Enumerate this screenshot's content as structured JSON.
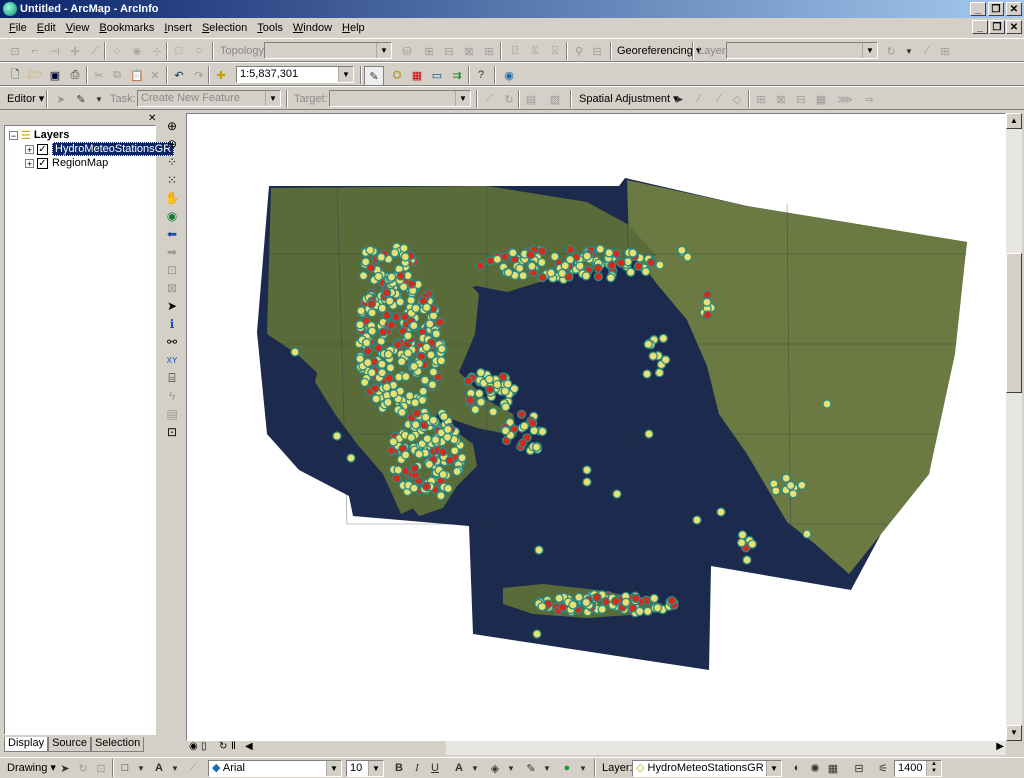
{
  "window": {
    "title": "Untitled - ArcMap - ArcInfo",
    "buttons": [
      "_",
      "❐",
      "✕"
    ]
  },
  "menubar": {
    "items": [
      {
        "key": "F",
        "rest": "ile"
      },
      {
        "key": "E",
        "rest": "dit"
      },
      {
        "key": "V",
        "rest": "iew"
      },
      {
        "key": "B",
        "rest": "ookmarks"
      },
      {
        "key": "I",
        "rest": "nsert"
      },
      {
        "key": "S",
        "rest": "election"
      },
      {
        "key": "T",
        "rest": "ools"
      },
      {
        "key": "W",
        "rest": "indow"
      },
      {
        "key": "H",
        "rest": "elp"
      }
    ]
  },
  "topology_toolbar": {
    "topology_label": "Topology:",
    "georeferencing_label": "Georeferencing",
    "layer_label": "Layer:"
  },
  "standard_toolbar": {
    "scale_value": "1:5,837,301"
  },
  "editor_toolbar": {
    "editor_label": "Editor",
    "task_label": "Task:",
    "task_value": "Create New Feature",
    "target_label": "Target:",
    "spatial_adjustment_label": "Spatial Adjustment"
  },
  "toc": {
    "root_label": "Layers",
    "layers": [
      {
        "name": "HydroMeteoStationsGR",
        "checked": true,
        "selected": true
      },
      {
        "name": "RegionMap",
        "checked": true,
        "selected": false
      }
    ],
    "tabs": [
      "Display",
      "Source",
      "Selection"
    ],
    "active_tab": "Display"
  },
  "map": {
    "colors": {
      "sea": "#1c2a4e",
      "land": "#5a6b3a",
      "station_fill": "#e8e070",
      "station_ring": "#2a8a86",
      "station_highlight": "#d42a1a"
    }
  },
  "drawing_toolbar": {
    "drawing_label": "Drawing",
    "font_value": "Arial",
    "size_value": "10",
    "layer_label": "Layer:",
    "layer_value": "HydroMeteoStationsGR",
    "number_value": "1400"
  }
}
